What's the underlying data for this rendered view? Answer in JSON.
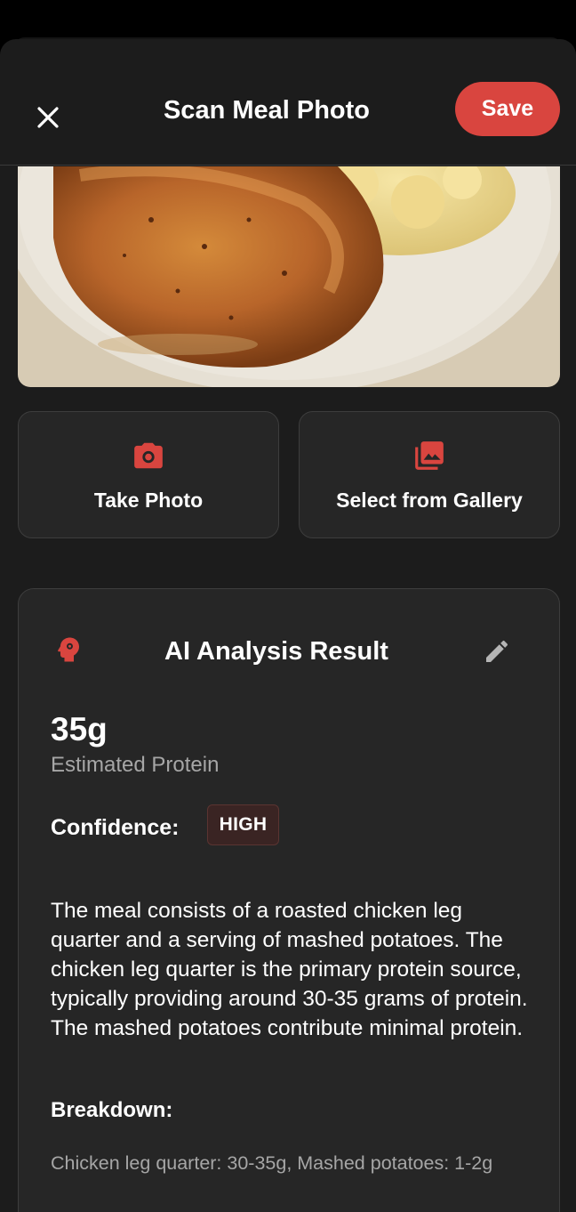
{
  "header": {
    "title": "Scan Meal Photo",
    "save_label": "Save",
    "close_icon": "close-icon"
  },
  "meal_photo": {
    "description_icon": "roasted-chicken-photo"
  },
  "actions": {
    "take_photo": {
      "label": "Take Photo",
      "icon": "camera-icon"
    },
    "gallery": {
      "label": "Select from Gallery",
      "icon": "photo-library-icon"
    }
  },
  "analysis": {
    "title": "AI Analysis Result",
    "head_icon": "psychology-icon",
    "edit_icon": "edit-icon",
    "protein_value": "35g",
    "protein_label": "Estimated Protein",
    "confidence_label": "Confidence:",
    "confidence_value": "HIGH",
    "description": "The meal consists of a roasted chicken leg quarter and a serving of mashed potatoes. The chicken leg quarter is the primary protein source, typically providing around 30-35 grams of protein. The mashed potatoes contribute minimal protein.",
    "breakdown_label": "Breakdown:",
    "breakdown_text": "Chicken leg quarter: 30-35g, Mashed potatoes: 1-2g"
  },
  "colors": {
    "accent": "#d9453f",
    "background": "#1c1c1c",
    "card": "#262626"
  }
}
